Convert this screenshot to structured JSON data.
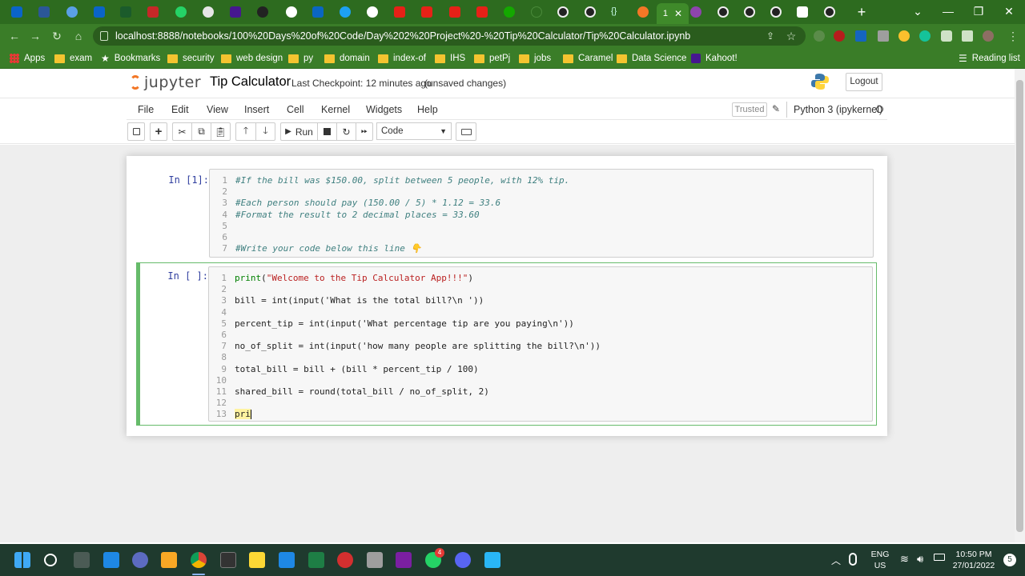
{
  "browser": {
    "active_tab_label": "1",
    "url": "localhost:8888/notebooks/100%20Days%20of%20Code/Day%202%20Project%20-%20Tip%20Calculator/Tip%20Calculator.ipynb",
    "bookmarks": [
      "Apps",
      "exam",
      "Bookmarks",
      "security",
      "web design",
      "py",
      "domain",
      "index-of",
      "IHS",
      "petPj",
      "jobs",
      "Caramel",
      "Data Science",
      "Kahoot!"
    ],
    "reading_list": "Reading list"
  },
  "jupyter": {
    "logo_text": "jupyter",
    "notebook_title": "Tip Calculator",
    "checkpoint": "Last Checkpoint: 12 minutes ago",
    "unsaved": "(unsaved changes)",
    "logout": "Logout",
    "menu": [
      "File",
      "Edit",
      "View",
      "Insert",
      "Cell",
      "Kernel",
      "Widgets",
      "Help"
    ],
    "trusted": "Trusted",
    "kernel": "Python 3 (ipykernel)",
    "run_label": "Run",
    "cell_type": "Code"
  },
  "cells": [
    {
      "prompt": "In [1]:",
      "lines": [
        "#If the bill was $150.00, split between 5 people, with 12% tip.",
        "",
        "#Each person should pay (150.00 / 5) * 1.12 = 33.6",
        "#Format the result to 2 decimal places = 33.60",
        "",
        "",
        "#Write your code below this line 👇"
      ]
    },
    {
      "prompt": "In [ ]:",
      "lines": [
        "print(\"Welcome to the Tip Calculator App!!!\")",
        "",
        "bill = int(input('What is the total bill?\\n '))",
        "",
        "percent_tip = int(input('What percentage tip are you paying\\n'))",
        "",
        "no_of_split = int(input('how many people are splitting the bill?\\n'))",
        "",
        "total_bill = bill + (bill * percent_tip / 100)",
        "",
        "shared_bill = round(total_bill / no_of_split, 2)",
        "",
        "pri"
      ]
    }
  ],
  "taskbar": {
    "lang_line1": "ENG",
    "lang_line2": "US",
    "time": "10:50 PM",
    "date": "27/01/2022",
    "notification_count": "5",
    "whatsapp_badge": "4"
  },
  "colors": {
    "tab_strip": "#2d6b1f",
    "toolbar": "#3a7d28",
    "selected_cell_border": "#66bb6a",
    "prompt_blue": "#303f9f"
  }
}
